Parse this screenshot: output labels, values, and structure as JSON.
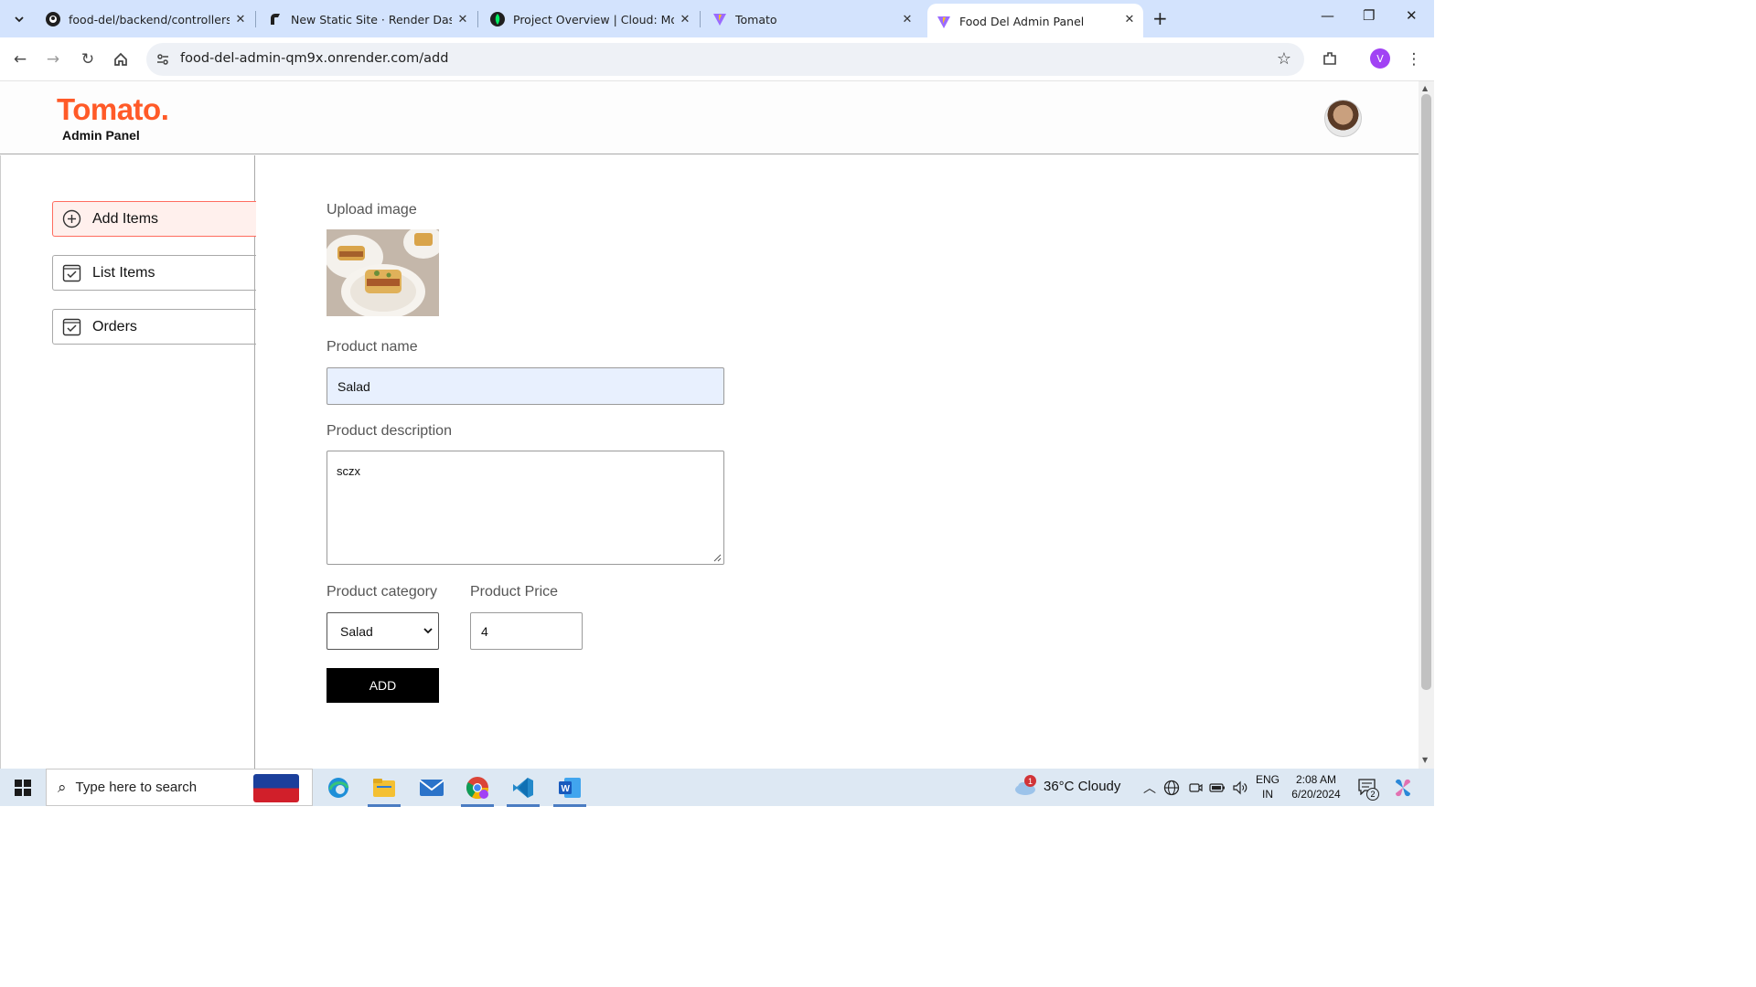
{
  "browser": {
    "tabs": [
      {
        "title": "food-del/backend/controllers/c",
        "favicon": "github-icon",
        "active": false
      },
      {
        "title": "New Static Site · Render Dashb",
        "favicon": "render-icon",
        "active": false
      },
      {
        "title": "Project Overview | Cloud: Mong",
        "favicon": "mongodb-leaf-icon",
        "active": false
      },
      {
        "title": "Tomato",
        "favicon": "vite-icon",
        "active": false
      },
      {
        "title": "Food Del Admin Panel",
        "favicon": "vite-icon",
        "active": true
      }
    ],
    "url": "food-del-admin-qm9x.onrender.com/add",
    "profile_initial": "V"
  },
  "app": {
    "logo": "Tomato.",
    "logo_subtitle": "Admin Panel",
    "brand_color": "#ff5a28",
    "sidebar": [
      {
        "label": "Add Items",
        "icon": "add-circle-icon",
        "active": true
      },
      {
        "label": "List Items",
        "icon": "checkbox-icon",
        "active": false
      },
      {
        "label": "Orders",
        "icon": "checkbox-icon",
        "active": false
      }
    ],
    "form": {
      "upload_label": "Upload image",
      "name_label": "Product name",
      "name_value": "Salad",
      "description_label": "Product description",
      "description_value": "sczx",
      "category_label": "Product category",
      "category_value": "Salad",
      "price_label": "Product Price",
      "price_value": "4",
      "submit_label": "ADD"
    }
  },
  "taskbar": {
    "search_placeholder": "Type here to search",
    "weather": "36°C  Cloudy",
    "weather_badge": "1",
    "lang_line1": "ENG",
    "lang_line2": "IN",
    "time": "2:08 AM",
    "date": "6/20/2024",
    "notifications": "2"
  }
}
